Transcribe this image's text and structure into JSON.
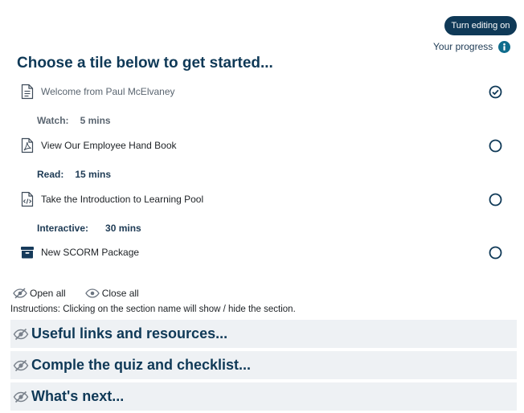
{
  "header": {
    "edit_button": "Turn editing on",
    "progress_label": "Your progress"
  },
  "main": {
    "heading": "Choose a tile below to get started..."
  },
  "activities": [
    {
      "name": "Welcome from Paul McElvaney",
      "icon": "document-icon",
      "complete": true,
      "meta_label": "Watch:",
      "meta_value": "5 mins"
    },
    {
      "name": "View Our Employee Hand Book",
      "icon": "pdf-icon",
      "complete": false,
      "meta_label": "Read:",
      "meta_value": "15 mins"
    },
    {
      "name": "Take the Introduction to Learning Pool",
      "icon": "code-file-icon",
      "complete": false,
      "meta_label": "Interactive:",
      "meta_value": "30 mins"
    },
    {
      "name": "New SCORM Package",
      "icon": "scorm-package-icon",
      "complete": false
    }
  ],
  "controls": {
    "open_all": "Open all",
    "close_all": "Close all",
    "instructions": "Instructions: Clicking on the section name will show / hide the section."
  },
  "sections": [
    {
      "title": "Useful links and resources..."
    },
    {
      "title": "Comple the quiz and checklist..."
    },
    {
      "title": "What's next..."
    }
  ],
  "colors": {
    "primary": "#0f3957",
    "info": "#0f6c8c",
    "section_bg": "#eef1f4",
    "text": "#1d2125",
    "muted": "#5a6570"
  }
}
